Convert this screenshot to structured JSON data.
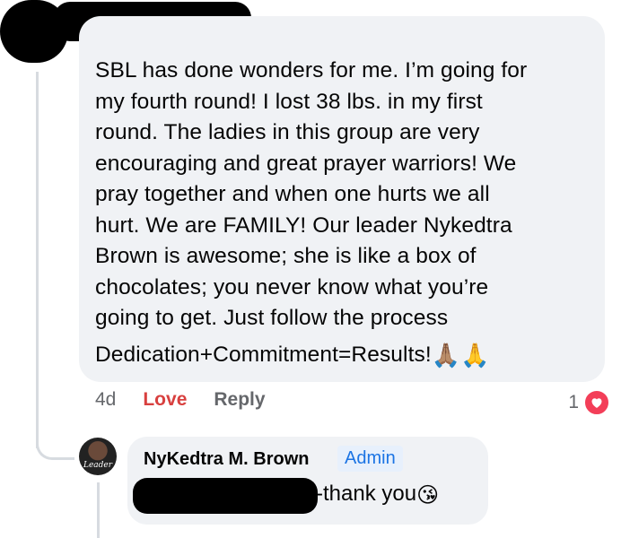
{
  "comment": {
    "lines": [
      "SBL has done wonders for me. I’m going for",
      "my fourth round! I lost 38 lbs. in my first",
      "round. The ladies in this group are very",
      "encouraging and great prayer warriors! We",
      "pray together and when one hurts we all",
      "hurt. We are FAMILY! Our leader Nykedtra",
      "Brown is awesome; she is like a box of",
      "chocolates; you never know what you’re",
      "going to get. Just follow the process",
      "Dedication+Commitment=Results!"
    ],
    "emoji": "🙏🏽🙏",
    "time": "4d",
    "love_label": "Love",
    "reply_label": "Reply",
    "reaction_count": "1",
    "reaction_icon": "heart-icon",
    "reaction_color": "#f33e58"
  },
  "reply": {
    "avatar_text": "Leader",
    "author": "NyKedtra M. Brown",
    "badge": "Admin",
    "text": "-thank you",
    "emoji": "😘"
  },
  "colors": {
    "bubble": "#f0f2f5",
    "love": "#d8403f",
    "meta": "#65676b",
    "badge_text": "#1b74e4",
    "badge_bg": "#e7f0fc"
  }
}
